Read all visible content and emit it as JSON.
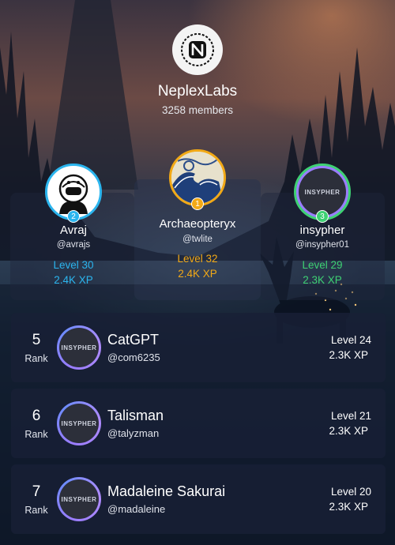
{
  "community": {
    "name": "NeplexLabs",
    "members": "3258 members",
    "logo_icon": "neplex-logo-icon"
  },
  "colors": {
    "second": "#2bb5ee",
    "first": "#f2a916",
    "third": "#3ed173"
  },
  "podium": [
    {
      "place": "2",
      "name": "Avraj",
      "handle": "@avrajs",
      "level": "Level 30",
      "xp": "2.4K XP",
      "avatar_icon": "astronaut-avatar-icon"
    },
    {
      "place": "1",
      "name": "Archaeopteryx",
      "handle": "@twlite",
      "level": "Level 32",
      "xp": "2.4K XP",
      "avatar_icon": "great-wave-avatar-icon"
    },
    {
      "place": "3",
      "name": "insypher",
      "handle": "@insypher01",
      "level": "Level 29",
      "xp": "2.3K XP",
      "avatar_text": "INSYPHER"
    }
  ],
  "ranks": [
    {
      "rank": "5",
      "rank_label": "Rank",
      "name": "CatGPT",
      "handle": "@com6235",
      "level": "Level 24",
      "xp": "2.3K XP",
      "avatar_text": "INSYPHER"
    },
    {
      "rank": "6",
      "rank_label": "Rank",
      "name": "Talisman",
      "handle": "@talyzman",
      "level": "Level 21",
      "xp": "2.3K XP",
      "avatar_text": "INSYPHER"
    },
    {
      "rank": "7",
      "rank_label": "Rank",
      "name": "Madaleine Sakurai",
      "handle": "@madaleine",
      "level": "Level 20",
      "xp": "2.3K XP",
      "avatar_text": "INSYPHER"
    }
  ]
}
